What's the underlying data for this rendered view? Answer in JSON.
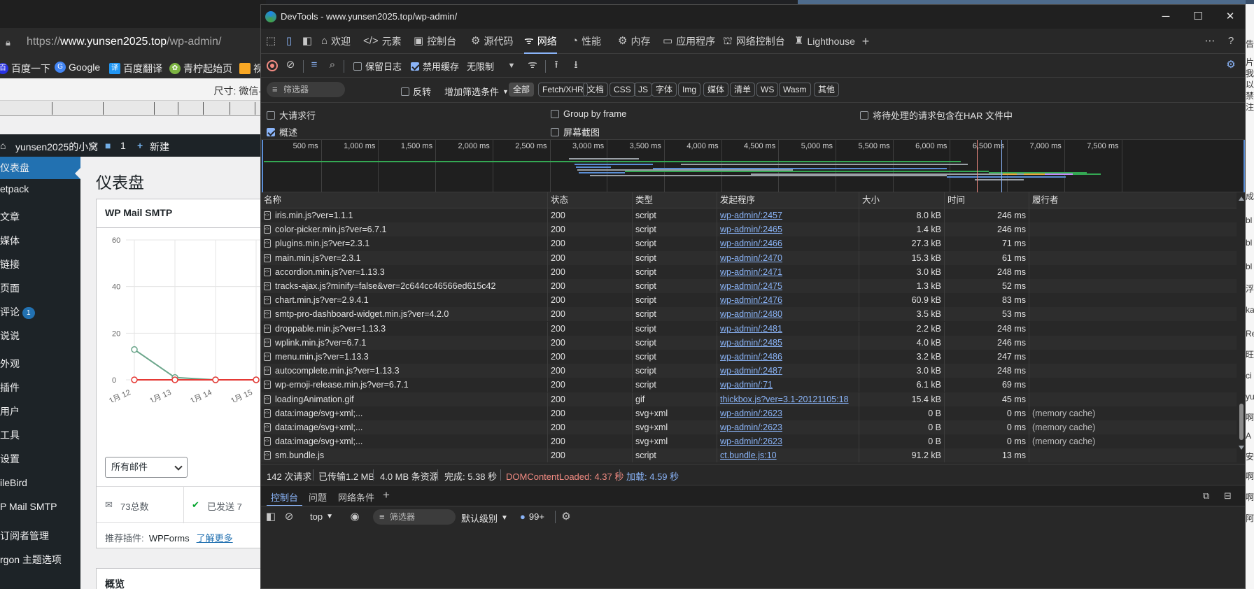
{
  "bg_browser": {
    "url_prefix": "https://",
    "url_host": "www.yunsen2025.top",
    "url_path": "/wp-admin/",
    "bookmarks": [
      "百度一下",
      "Google",
      "百度翻译",
      "青柠起始页",
      "视"
    ],
    "size_label": "尺寸: 微信-"
  },
  "wp": {
    "adminbar": {
      "site": "yunsen2025的小窝",
      "comments": "1",
      "new": "新建"
    },
    "sidebar": [
      {
        "label": "仪表盘",
        "badge": ""
      },
      {
        "label": "etpack",
        "badge": ""
      },
      {
        "label": "文章",
        "badge": ""
      },
      {
        "label": "媒体",
        "badge": ""
      },
      {
        "label": "链接",
        "badge": ""
      },
      {
        "label": "页面",
        "badge": ""
      },
      {
        "label": "评论",
        "badge": "1"
      },
      {
        "label": "说说",
        "badge": ""
      },
      {
        "label": "外观",
        "badge": ""
      },
      {
        "label": "插件",
        "badge": ""
      },
      {
        "label": "用户",
        "badge": ""
      },
      {
        "label": "工具",
        "badge": ""
      },
      {
        "label": "设置",
        "badge": ""
      },
      {
        "label": "ileBird",
        "badge": ""
      },
      {
        "label": "P Mail SMTP",
        "badge": ""
      },
      {
        "label": "订阅者管理",
        "badge": ""
      },
      {
        "label": "rgon 主题选项",
        "badge": ""
      }
    ],
    "page_title": "仪表盘",
    "widget_title": "WP Mail SMTP",
    "chart_data": {
      "type": "line",
      "categories": [
        "1月 12",
        "1月 13",
        "1月 14",
        "1月 15"
      ],
      "series": [
        {
          "values": [
            13,
            1,
            0,
            0
          ],
          "color": "#6aa58a"
        },
        {
          "values": [
            0,
            0,
            0,
            0
          ],
          "color": "#e53935"
        }
      ],
      "yticks": [
        "0",
        "20",
        "40",
        "60"
      ],
      "ylim": [
        0,
        60
      ]
    },
    "select_value": "所有邮件",
    "total_label": "73总数",
    "sent_label": "已发送 7",
    "plugins_label": "推荐插件:",
    "plugins_name": "WPForms",
    "learn_more": "了解更多",
    "overview_title": "概览"
  },
  "devtools": {
    "title": "DevTools - www.yunsen2025.top/wp-admin/",
    "tabs": [
      "欢迎",
      "元素",
      "控制台",
      "源代码",
      "网络",
      "性能",
      "内存",
      "应用程序",
      "网络控制台",
      "Lighthouse"
    ],
    "active_tab": "网络",
    "toolbar": {
      "preserve_log": "保留日志",
      "disable_cache": "禁用缓存",
      "throttle": "无限制"
    },
    "filter": {
      "placeholder": "筛选器",
      "invert": "反转",
      "more_filters": "增加筛选条件",
      "chips": [
        "全部",
        "Fetch/XHR",
        "文档",
        "CSS",
        "JS",
        "字体",
        "Img",
        "媒体",
        "清单",
        "WS",
        "Wasm",
        "其他"
      ]
    },
    "options": {
      "big_rows": "大请求行",
      "group_by_frame": "Group by frame",
      "har_pending": "将待处理的请求包含在HAR 文件中",
      "overview": "概述",
      "screenshots": "屏幕截图"
    },
    "timeline_labels": [
      "500 ms",
      "1,000 ms",
      "1,500 ms",
      "2,000 ms",
      "2,500 ms",
      "3,000 ms",
      "3,500 ms",
      "4,000 ms",
      "4,500 ms",
      "5,000 ms",
      "5,500 ms",
      "6,000 ms",
      "6,500 ms",
      "7,000 ms",
      "7,500 ms"
    ],
    "columns": [
      "名称",
      "状态",
      "类型",
      "发起程序",
      "大小",
      "时间",
      "履行者"
    ],
    "rows": [
      {
        "name": "iris.min.js?ver=1.1.1",
        "status": "200",
        "type": "script",
        "initiator": "wp-admin/:2457",
        "size": "8.0 kB",
        "time": "246 ms",
        "fulfilled": ""
      },
      {
        "name": "color-picker.min.js?ver=6.7.1",
        "status": "200",
        "type": "script",
        "initiator": "wp-admin/:2465",
        "size": "1.4 kB",
        "time": "246 ms",
        "fulfilled": ""
      },
      {
        "name": "plugins.min.js?ver=2.3.1",
        "status": "200",
        "type": "script",
        "initiator": "wp-admin/:2466",
        "size": "27.3 kB",
        "time": "71 ms",
        "fulfilled": ""
      },
      {
        "name": "main.min.js?ver=2.3.1",
        "status": "200",
        "type": "script",
        "initiator": "wp-admin/:2470",
        "size": "15.3 kB",
        "time": "61 ms",
        "fulfilled": ""
      },
      {
        "name": "accordion.min.js?ver=1.13.3",
        "status": "200",
        "type": "script",
        "initiator": "wp-admin/:2471",
        "size": "3.0 kB",
        "time": "248 ms",
        "fulfilled": ""
      },
      {
        "name": "tracks-ajax.js?minify=false&ver=2c644cc46566ed615c42",
        "status": "200",
        "type": "script",
        "initiator": "wp-admin/:2475",
        "size": "1.3 kB",
        "time": "52 ms",
        "fulfilled": ""
      },
      {
        "name": "chart.min.js?ver=2.9.4.1",
        "status": "200",
        "type": "script",
        "initiator": "wp-admin/:2476",
        "size": "60.9 kB",
        "time": "83 ms",
        "fulfilled": ""
      },
      {
        "name": "smtp-pro-dashboard-widget.min.js?ver=4.2.0",
        "status": "200",
        "type": "script",
        "initiator": "wp-admin/:2480",
        "size": "3.5 kB",
        "time": "53 ms",
        "fulfilled": ""
      },
      {
        "name": "droppable.min.js?ver=1.13.3",
        "status": "200",
        "type": "script",
        "initiator": "wp-admin/:2481",
        "size": "2.2 kB",
        "time": "248 ms",
        "fulfilled": ""
      },
      {
        "name": "wplink.min.js?ver=6.7.1",
        "status": "200",
        "type": "script",
        "initiator": "wp-admin/:2485",
        "size": "4.0 kB",
        "time": "246 ms",
        "fulfilled": ""
      },
      {
        "name": "menu.min.js?ver=1.13.3",
        "status": "200",
        "type": "script",
        "initiator": "wp-admin/:2486",
        "size": "3.2 kB",
        "time": "247 ms",
        "fulfilled": ""
      },
      {
        "name": "autocomplete.min.js?ver=1.13.3",
        "status": "200",
        "type": "script",
        "initiator": "wp-admin/:2487",
        "size": "3.0 kB",
        "time": "248 ms",
        "fulfilled": ""
      },
      {
        "name": "wp-emoji-release.min.js?ver=6.7.1",
        "status": "200",
        "type": "script",
        "initiator": "wp-admin/:71",
        "size": "6.1 kB",
        "time": "69 ms",
        "fulfilled": ""
      },
      {
        "name": "loadingAnimation.gif",
        "status": "200",
        "type": "gif",
        "initiator": "thickbox.js?ver=3.1-20121105:18",
        "size": "15.4 kB",
        "time": "45 ms",
        "fulfilled": ""
      },
      {
        "name": "data:image/svg+xml;...",
        "status": "200",
        "type": "svg+xml",
        "initiator": "wp-admin/:2623",
        "size": "0 B",
        "time": "0 ms",
        "fulfilled": "(memory cache)"
      },
      {
        "name": "data:image/svg+xml;...",
        "status": "200",
        "type": "svg+xml",
        "initiator": "wp-admin/:2623",
        "size": "0 B",
        "time": "0 ms",
        "fulfilled": "(memory cache)"
      },
      {
        "name": "data:image/svg+xml;...",
        "status": "200",
        "type": "svg+xml",
        "initiator": "wp-admin/:2623",
        "size": "0 B",
        "time": "0 ms",
        "fulfilled": "(memory cache)"
      },
      {
        "name": "sm.bundle.js",
        "status": "200",
        "type": "script",
        "initiator": "ct.bundle.js:10",
        "size": "91.2 kB",
        "time": "13 ms",
        "fulfilled": ""
      }
    ],
    "status": {
      "requests": "142 次请求",
      "transferred": "已传输1.2 MB",
      "resources": "4.0 MB 条资源",
      "finish": "完成: 5.38 秒",
      "dcl": "DOMContentLoaded: 4.37 秒",
      "load": "加载: 4.59 秒"
    },
    "drawer_tabs": [
      "控制台",
      "问题",
      "网络条件"
    ],
    "console": {
      "context": "top",
      "filter": "筛选器",
      "level": "默认级别",
      "issues": "99+"
    },
    "colors": {
      "accent": "#8ab4f8",
      "dcl": "#f28b82",
      "load": "#8ab4f8"
    }
  },
  "bg_right_text": [
    "告",
    "片",
    "我",
    "以",
    "禁",
    "注",
    "成",
    "bl",
    "bl",
    "bl",
    "浮",
    "ka",
    "Re",
    "旺",
    "ci",
    "yu",
    "啊",
    "A",
    "安",
    "啊",
    "啊",
    "阿"
  ]
}
